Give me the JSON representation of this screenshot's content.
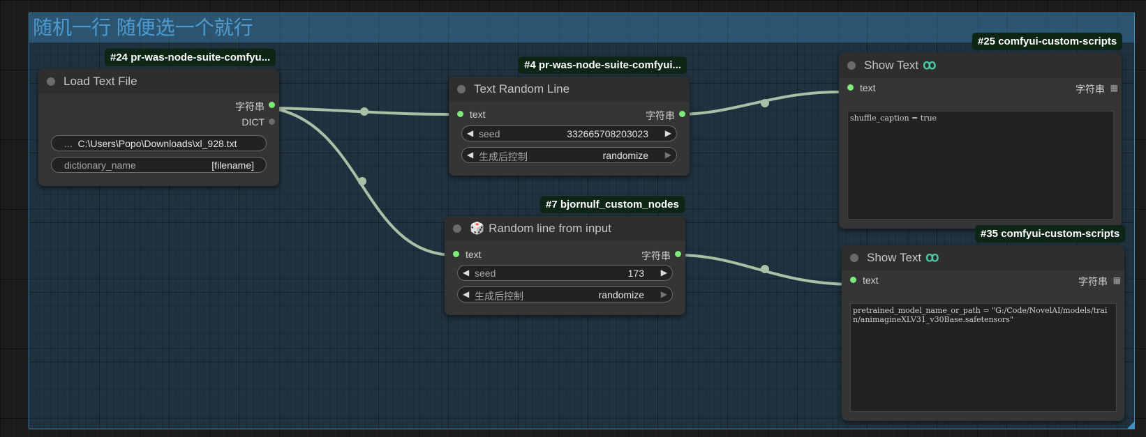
{
  "group": {
    "title": "随机一行 随便选一个就行"
  },
  "nodes": {
    "load_text_file": {
      "badge": "#24 pr-was-node-suite-comfyu...",
      "title": "Load Text File",
      "outputs": [
        "字符串",
        "DICT"
      ],
      "file_path": "C:\\Users\\Popo\\Downloads\\xl_928.txt",
      "file_prefix": "...",
      "dict_label": "dictionary_name",
      "dict_value": "[filename]"
    },
    "text_random_line": {
      "badge": "#4 pr-was-node-suite-comfyui...",
      "title": "Text Random Line",
      "input": "text",
      "output": "字符串",
      "seed_label": "seed",
      "seed_value": "332665708203023",
      "control_label": "生成后控制",
      "control_value": "randomize"
    },
    "random_line_input": {
      "badge": "#7 bjornulf_custom_nodes",
      "title": "Random line from input",
      "input": "text",
      "output": "字符串",
      "seed_label": "seed",
      "seed_value": "173",
      "control_label": "生成后控制",
      "control_value": "randomize"
    },
    "show_text_1": {
      "badge": "#25 comfyui-custom-scripts",
      "title": "Show Text",
      "input": "text",
      "output": "字符串",
      "content": "shuffle_caption = true"
    },
    "show_text_2": {
      "badge": "#35 comfyui-custom-scripts",
      "title": "Show Text",
      "input": "text",
      "output": "字符串",
      "content": "pretrained_model_name_or_path = \"G:/Code/NovelAI/models/train/animagineXLV31_v30Base.safetensors\""
    }
  },
  "colors": {
    "link": "#a9bfa8",
    "slot_connected": "#7dea79",
    "group_border": "#3f8fbf",
    "badge_bg": "#0d2515"
  }
}
